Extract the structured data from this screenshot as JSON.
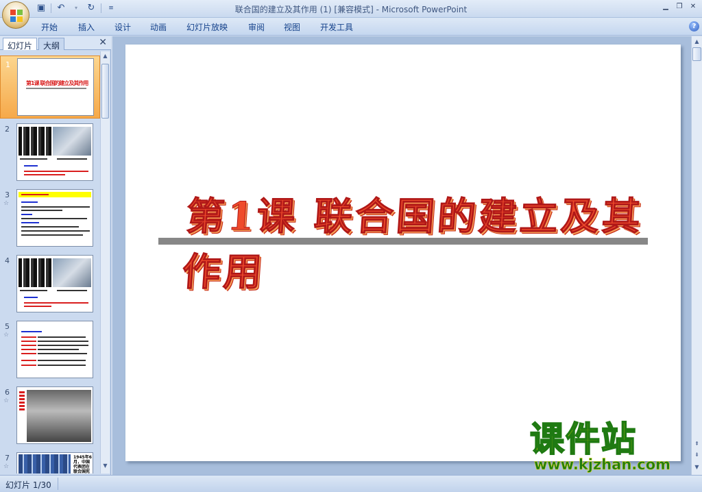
{
  "window": {
    "title": "联合国的建立及其作用 (1) [兼容模式] - Microsoft PowerPoint"
  },
  "quick_access": {
    "icons": [
      "save-icon",
      "undo-icon",
      "redo-icon",
      "customize-icon"
    ]
  },
  "ribbon": {
    "tabs": [
      "开始",
      "插入",
      "设计",
      "动画",
      "幻灯片放映",
      "审阅",
      "视图",
      "开发工具"
    ]
  },
  "left_panel": {
    "tabs": [
      "幻灯片",
      "大纲"
    ],
    "slides": [
      {
        "num": "1"
      },
      {
        "num": "2"
      },
      {
        "num": "3"
      },
      {
        "num": "4"
      },
      {
        "num": "5"
      },
      {
        "num": "6"
      },
      {
        "num": "7"
      }
    ],
    "slide7_text": "1945年6月，中国代表团在联合国宪"
  },
  "slide": {
    "title": "第1课  联合国的建立及其作用"
  },
  "watermark": {
    "name": "课件站",
    "url": "www.kjzhan.com"
  },
  "status": {
    "slide_indicator": "幻灯片 1/30"
  },
  "colors": {
    "title_red": "#ef4b2b",
    "ribbon_text": "#15428b",
    "selected_thumb": "#f6a94a",
    "watermark_yellow": "#f4e600",
    "watermark_green": "#1f7a12"
  }
}
